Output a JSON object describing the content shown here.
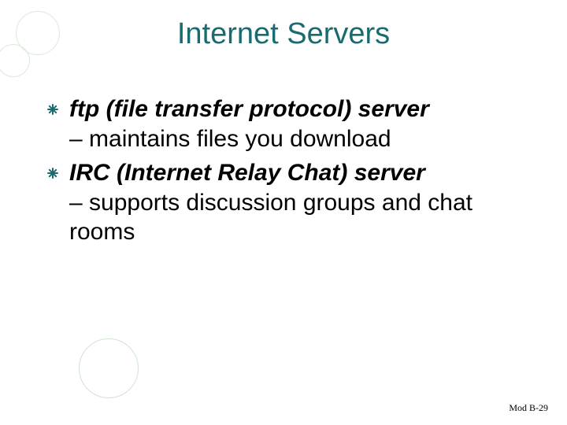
{
  "title": "Internet Servers",
  "items": [
    {
      "term": "ftp (file transfer protocol) server",
      "desc": "– maintains files you download"
    },
    {
      "term": "IRC (Internet Relay Chat) server",
      "desc": "– supports discussion groups and chat rooms"
    }
  ],
  "footer": "Mod B-29",
  "colors": {
    "title": "#1a6b6f",
    "bullet": "#1a6b6f",
    "decor": "#d9e9d8"
  }
}
